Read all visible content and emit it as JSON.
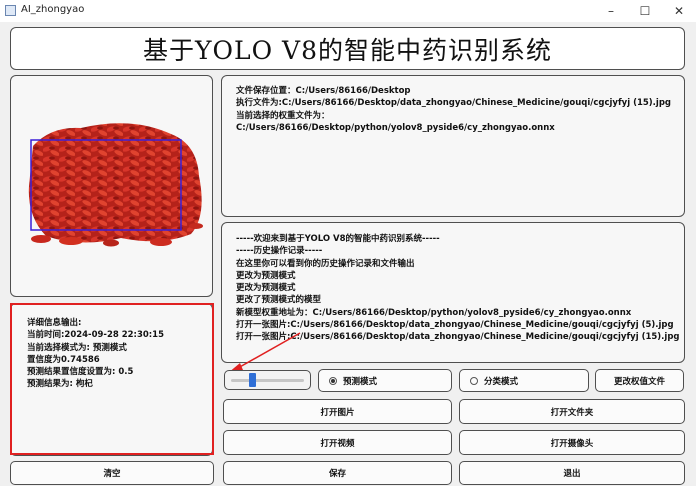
{
  "window": {
    "title": "AI_zhongyao",
    "minimize": "–",
    "maximize": "☐",
    "close": "✕"
  },
  "banner": {
    "title": "基于YOLO V8的智能中药识别系统"
  },
  "file_info": {
    "lines": [
      "文件保存位置：C:/Users/86166/Desktop",
      "执行文件为:C:/Users/86166/Desktop/data_zhongyao/Chinese_Medicine/gouqi/cgcjyfyj (15).jpg",
      "当前选择的权重文件为：",
      "C:/Users/86166/Desktop/python/yolov8_pyside6/cy_zhongyao.onnx"
    ]
  },
  "history": {
    "lines": [
      "-----欢迎来到基于YOLO V8的智能中药识别系统-----",
      "-----历史操作记录-----",
      "在这里你可以看到你的历史操作记录和文件输出",
      "更改为预测模式",
      "更改为预测模式",
      "更改了预测模式的模型",
      "新模型权重地址为：C:/Users/86166/Desktop/python/yolov8_pyside6/cy_zhongyao.onnx",
      "打开一张图片:C:/Users/86166/Desktop/data_zhongyao/Chinese_Medicine/gouqi/cgcjyfyj (5).jpg",
      "打开一张图片:C:/Users/86166/Desktop/data_zhongyao/Chinese_Medicine/gouqi/cgcjyfyj (15).jpg"
    ]
  },
  "details": {
    "lines": [
      "详细信息输出:",
      "当前时间:2024-09-28 22:30:15",
      "当前选择模式为:  预测模式",
      "置信度为0.74586",
      "预测结果置信度设置为:  0.5",
      "预测结果为:  枸杞"
    ]
  },
  "slider": {
    "value": 0.27
  },
  "modes": {
    "predict": "预测模式",
    "classify": "分类模式",
    "selected": "predict"
  },
  "buttons": {
    "change_weights": "更改权值文件",
    "open_image": "打开图片",
    "open_folder": "打开文件夹",
    "open_video": "打开视频",
    "open_camera": "打开摄像头",
    "clear": "清空",
    "save": "保存",
    "exit": "退出"
  },
  "colors": {
    "detection_box": "#3b1fd8",
    "highlight": "#e02020",
    "goji": "#c8281e"
  }
}
